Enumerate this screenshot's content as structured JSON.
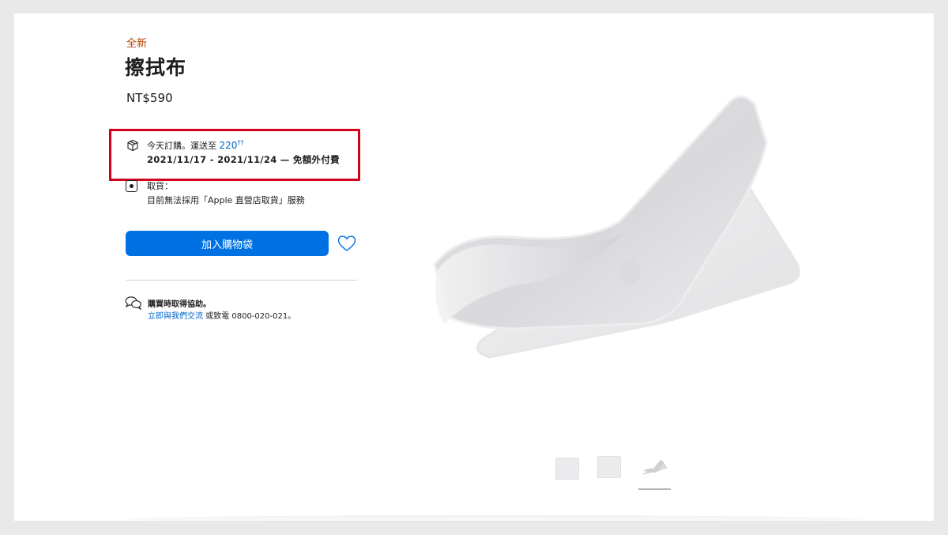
{
  "product": {
    "new_tag": "全新",
    "title": "擦拭布",
    "price": "NT$590"
  },
  "delivery": {
    "line1_prefix": "今天訂購。運送至",
    "zip": "220",
    "zip_mark": "††",
    "dates": "2021/11/17 - 2021/11/24 — 免額外付費",
    "icon": "box-icon"
  },
  "pickup": {
    "label": "取貨：",
    "text": "目前無法採用「Apple 直營店取貨」服務",
    "icon": "apple-store-icon"
  },
  "actions": {
    "add_to_bag": "加入購物袋",
    "favorite_icon": "heart-icon"
  },
  "help": {
    "title": "購買時取得協助。",
    "chat_link": "立即與我們交流",
    "phone_text": " 或致電 0800-020-021。",
    "icon": "chat-bubbles-icon"
  },
  "gallery": {
    "thumbnails": [
      "thumbnail-1",
      "thumbnail-2",
      "thumbnail-3"
    ],
    "selected_index": 2
  },
  "colors": {
    "accent_blue": "#0071e3",
    "link_blue": "#0066cc",
    "new_tag": "#b64400",
    "highlight_red": "#d0021b"
  }
}
